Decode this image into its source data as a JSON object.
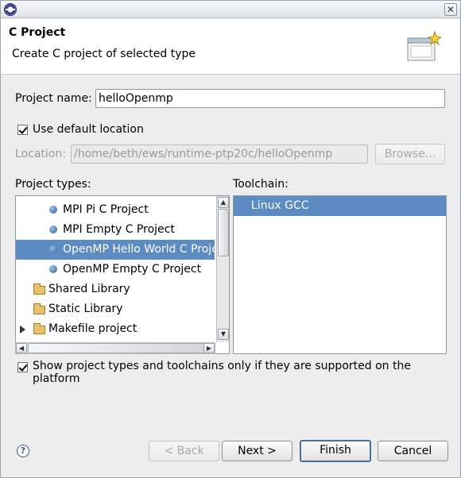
{
  "window": {
    "close_glyph": "✕"
  },
  "header": {
    "title": "C Project",
    "description": "Create C project of selected type"
  },
  "project_name": {
    "label": "Project name:",
    "value": "helloOpenmp"
  },
  "default_location": {
    "label": "Use default location",
    "checked": true
  },
  "location": {
    "label": "Location:",
    "value": "/home/beth/ews/runtime-ptp20c/helloOpenmp",
    "browse_label": "Browse..."
  },
  "project_types": {
    "label": "Project types:",
    "items": [
      {
        "label": "MPI Pi C Project",
        "icon": "bullet-icon",
        "selected": false
      },
      {
        "label": "MPI Empty C Project",
        "icon": "bullet-icon",
        "selected": false
      },
      {
        "label": "OpenMP Hello World C Project",
        "icon": "bullet-icon",
        "selected": true
      },
      {
        "label": "OpenMP Empty C Project",
        "icon": "bullet-icon",
        "selected": false
      },
      {
        "label": "Shared Library",
        "icon": "folder-icon",
        "selected": false
      },
      {
        "label": "Static Library",
        "icon": "folder-icon",
        "selected": false
      },
      {
        "label": "Makefile project",
        "icon": "folder-icon",
        "selected": false,
        "collapsed": true
      }
    ]
  },
  "toolchain": {
    "label": "Toolchain:",
    "items": [
      {
        "label": "Linux GCC",
        "selected": true
      }
    ]
  },
  "supported_filter": {
    "label": "Show project types and toolchains only if they are supported on the platform",
    "checked": true
  },
  "buttons": {
    "back": "< Back",
    "next": "Next >",
    "finish": "Finish",
    "cancel": "Cancel"
  },
  "colors": {
    "selection": "#5d8bc3"
  }
}
